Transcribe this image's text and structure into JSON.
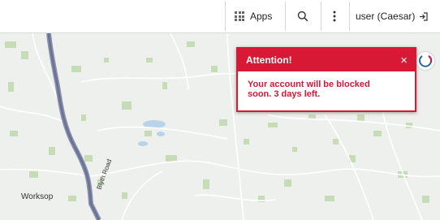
{
  "header": {
    "apps_label": "Apps",
    "apps_icon": "apps-grid-icon",
    "search_icon": "search-icon",
    "more_icon": "more-vertical-icon",
    "user_label": "user (Caesar)",
    "logout_icon": "logout-icon"
  },
  "map": {
    "labels": {
      "town": "Worksop",
      "road": "Blyth Road"
    }
  },
  "alert": {
    "title": "Attention!",
    "close": "×",
    "message": "Your account will be blocked soon. 3 days left."
  },
  "colors": {
    "alert_red": "#d71935",
    "road": "#6c7396",
    "greenery": "#c6dcb6"
  }
}
